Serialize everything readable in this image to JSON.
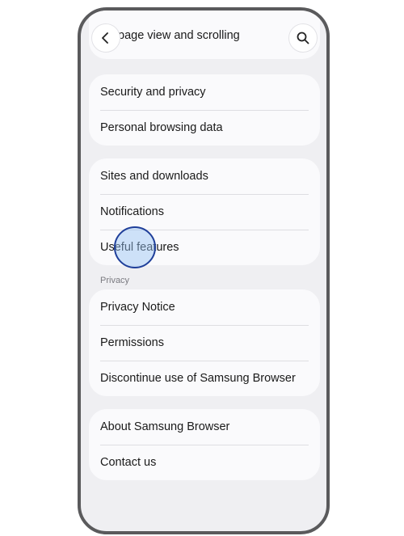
{
  "header": {
    "partial_item_label": "page view and scrolling",
    "back_icon": "chevron-left-icon",
    "search_icon": "search-icon"
  },
  "groups": {
    "security": [
      "Security and privacy",
      "Personal browsing data"
    ],
    "general": [
      "Sites and downloads",
      "Notifications",
      "Useful features"
    ],
    "privacy_label": "Privacy",
    "privacy": [
      "Privacy Notice",
      "Permissions",
      "Discontinue use of Samsung Browser"
    ],
    "about": [
      "About Samsung Browser",
      "Contact us"
    ]
  },
  "colors": {
    "background": "#efeff2",
    "card": "#fafafc",
    "touch_indicator_border": "#1f3f9a"
  }
}
